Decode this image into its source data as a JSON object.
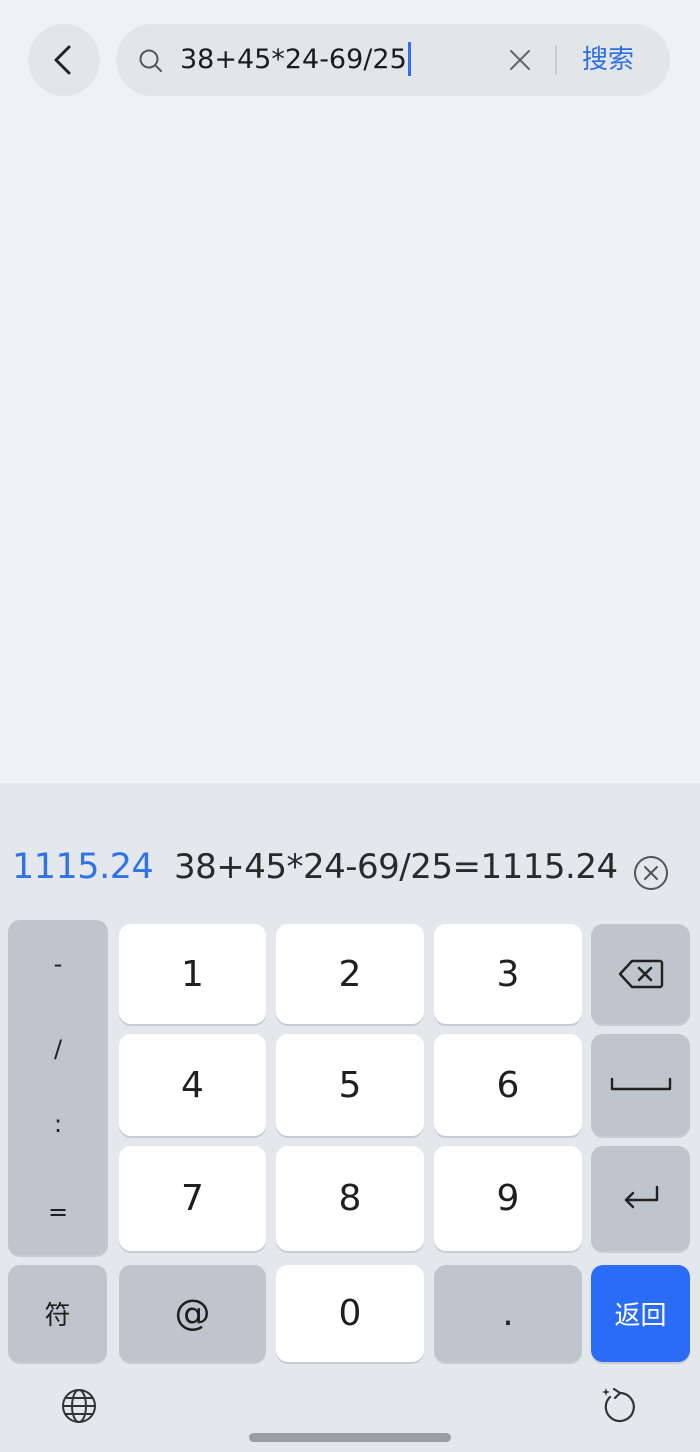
{
  "header": {
    "back_icon": "chevron-left-icon",
    "search": {
      "icon": "search-icon",
      "value": "38+45*24-69/25",
      "clear_icon": "close-icon",
      "button_label": "搜索"
    }
  },
  "keyboard": {
    "candidates": {
      "result": "1115.24",
      "expression": "38+45*24-69/25=1115.24",
      "close_icon": "close-circle-icon"
    },
    "symbols": [
      "-",
      "/",
      ":",
      "="
    ],
    "digits": [
      "1",
      "2",
      "3",
      "4",
      "5",
      "6",
      "7",
      "8",
      "9",
      "0"
    ],
    "keys": {
      "backspace_icon": "backspace-icon",
      "space_icon": "space-icon",
      "enter_icon": "enter-icon",
      "symbol_label": "符",
      "at_label": "@",
      "dot_label": ".",
      "return_label": "返回"
    },
    "bottom": {
      "globe_icon": "globe-icon",
      "collapse_icon": "collapse-keyboard-icon"
    },
    "colors": {
      "accent": "#2a6cf5",
      "candidate_text": "#2f73e8",
      "key_white": "#ffffff",
      "key_gray": "#bfc5cc"
    }
  }
}
